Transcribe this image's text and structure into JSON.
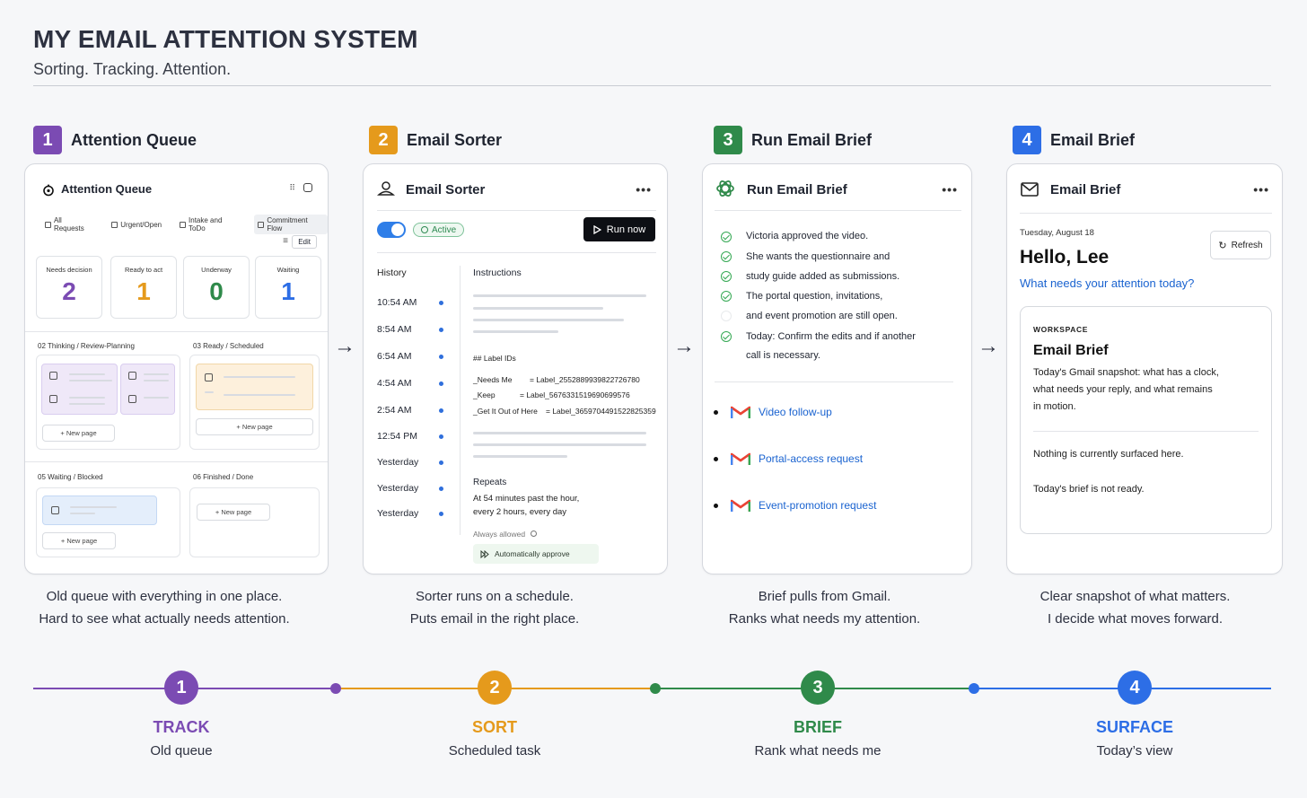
{
  "header": {
    "title": "MY EMAIL ATTENTION SYSTEM",
    "subtitle": "Sorting. Tracking. Attention."
  },
  "colors": {
    "purple": "#7b4bb3",
    "orange": "#e59a1c",
    "green": "#2f8a4a",
    "blue": "#2d6ee6"
  },
  "steps": [
    {
      "num": "1",
      "title": "Attention Queue"
    },
    {
      "num": "2",
      "title": "Email Sorter"
    },
    {
      "num": "3",
      "title": "Run Email Brief"
    },
    {
      "num": "4",
      "title": "Email Brief"
    }
  ],
  "queue": {
    "title": "Attention Queue",
    "tabs": [
      "All Requests",
      "Urgent/Open",
      "Intake and ToDo",
      "Commitment Flow"
    ],
    "edit": "Edit",
    "stats": [
      {
        "label": "Needs decision",
        "value": "2"
      },
      {
        "label": "Ready to act",
        "value": "1"
      },
      {
        "label": "Underway",
        "value": "0"
      },
      {
        "label": "Waiting",
        "value": "1"
      }
    ],
    "sections": [
      "02 Thinking / Review-Planning",
      "03 Ready / Scheduled",
      "05 Waiting / Blocked",
      "06 Finished / Done"
    ],
    "new_page": "+ New page"
  },
  "sorter": {
    "title": "Email Sorter",
    "status": "Active",
    "run": "Run now",
    "history_label": "History",
    "history": [
      "10:54 AM",
      "8:54 AM",
      "6:54 AM",
      "4:54 AM",
      "2:54 AM",
      "12:54 PM",
      "Yesterday",
      "Yesterday",
      "Yesterday"
    ],
    "instructions_label": "Instructions",
    "label_ids_heading": "## Label IDs",
    "labels": [
      {
        "name": "_Needs Me",
        "value": "= Label_2552889939822726780"
      },
      {
        "name": "_Keep",
        "value": "= Label_5676331519690699576"
      },
      {
        "name": "_Get It Out of Here",
        "value": "= Label_3659704491522825359"
      }
    ],
    "repeats_label": "Repeats",
    "repeats_line1": "At 54 minutes past the hour,",
    "repeats_line2": "every 2 hours, every day",
    "always_allowed": "Always allowed",
    "auto_approve": "Automatically approve"
  },
  "run_brief": {
    "title": "Run Email Brief",
    "lines": [
      "Victoria approved the video.",
      "She wants the questionnaire and",
      "study guide added as submissions.",
      "The portal question, invitations,",
      "and event promotion are still open.",
      "Today: Confirm the edits and if another",
      "call is necessary."
    ],
    "links": [
      "Video follow-up",
      "Portal-access request",
      "Event-promotion request"
    ]
  },
  "brief": {
    "title": "Email Brief",
    "date": "Tuesday, August 18",
    "refresh": "Refresh",
    "greeting": "Hello, Lee",
    "question": "What needs your attention today?",
    "workspace": "WORKSPACE",
    "card_title": "Email Brief",
    "desc1": "Today's Gmail snapshot: what has a clock,",
    "desc2": "what needs your reply, and what remains",
    "desc3": "in motion.",
    "status1": "Nothing is currently surfaced here.",
    "status2": "Today's brief is not ready."
  },
  "captions": [
    [
      "Old queue with everything in one place.",
      "Hard to see what actually needs attention."
    ],
    [
      "Sorter runs on a schedule.",
      "Puts email in the right place."
    ],
    [
      "Brief pulls from Gmail.",
      "Ranks what needs my attention."
    ],
    [
      "Clear snapshot of what matters.",
      "I decide what moves forward."
    ]
  ],
  "timeline": [
    {
      "num": "1",
      "label": "TRACK",
      "sub": "Old queue"
    },
    {
      "num": "2",
      "label": "SORT",
      "sub": "Scheduled task"
    },
    {
      "num": "3",
      "label": "BRIEF",
      "sub": "Rank what needs me"
    },
    {
      "num": "4",
      "label": "SURFACE",
      "sub": "Today’s view"
    }
  ]
}
